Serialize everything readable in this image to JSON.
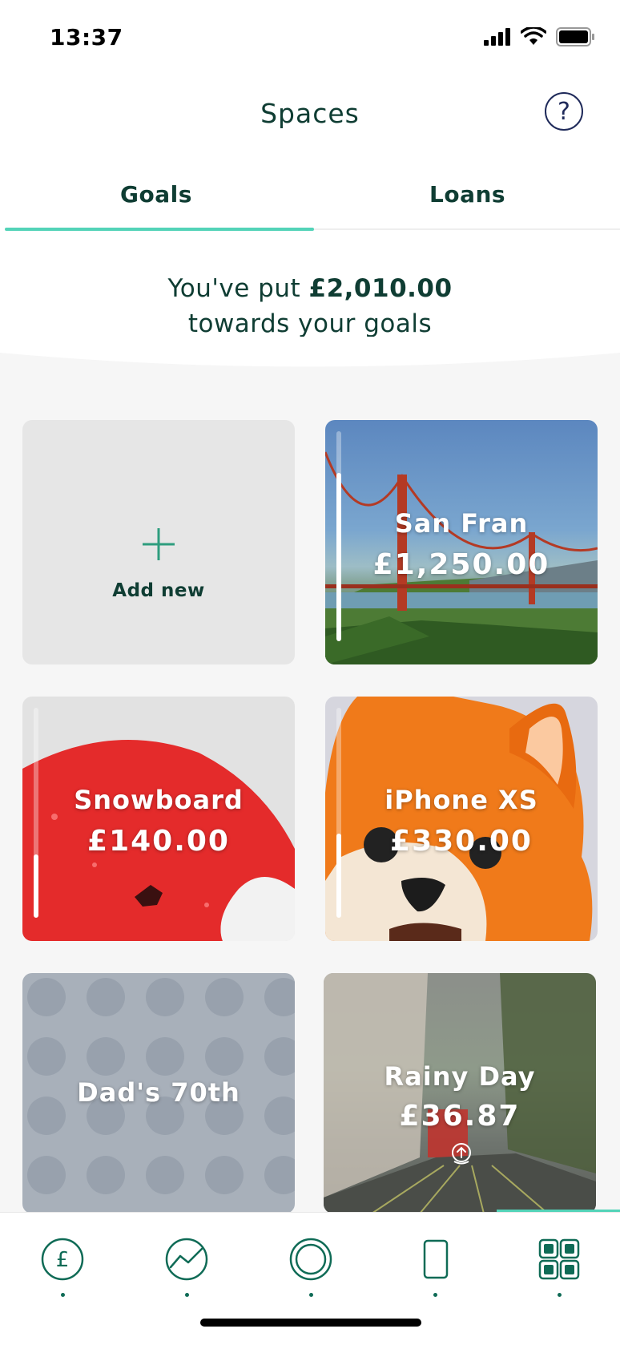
{
  "status_bar": {
    "time": "13:37"
  },
  "header": {
    "title": "Spaces",
    "help_icon": "question-mark-icon"
  },
  "tabs": [
    {
      "label": "Goals",
      "active": true
    },
    {
      "label": "Loans",
      "active": false
    }
  ],
  "summary": {
    "prefix": "You've put",
    "amount": "£2,010.00",
    "suffix": "towards your goals"
  },
  "add_new": {
    "label": "Add new",
    "icon": "plus-icon"
  },
  "goals": [
    {
      "name": "San Fran",
      "amount": "£1,250.00",
      "progress": 0.8
    },
    {
      "name": "Snowboard",
      "amount": "£140.00",
      "progress": 0.3
    },
    {
      "name": "iPhone XS",
      "amount": "£330.00",
      "progress": 0.4
    },
    {
      "name": "Dad's 70th",
      "amount": "",
      "progress": 0
    },
    {
      "name": "Rainy Day",
      "amount": "£36.87",
      "progress": 0
    }
  ],
  "tabbar": {
    "items": [
      {
        "icon": "pound-icon"
      },
      {
        "icon": "trend-icon"
      },
      {
        "icon": "ring-icon"
      },
      {
        "icon": "card-icon"
      },
      {
        "icon": "grid-icon",
        "active": true
      }
    ]
  },
  "colors": {
    "accent": "#53d3b8",
    "brand": "#0f3d33",
    "primary": "#0f6b56"
  }
}
